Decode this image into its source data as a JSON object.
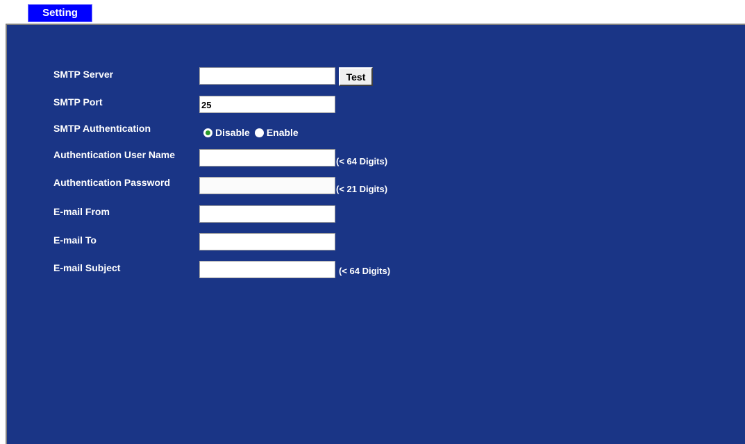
{
  "tab": {
    "label": "Setting"
  },
  "form": {
    "smtp_server": {
      "label": "SMTP Server",
      "value": ""
    },
    "test_button": {
      "label": "Test"
    },
    "smtp_port": {
      "label": "SMTP Port",
      "value": "25"
    },
    "smtp_auth": {
      "label": "SMTP Authentication",
      "options": [
        "Disable",
        "Enable"
      ],
      "selected": "Disable"
    },
    "auth_user": {
      "label": "Authentication User Name",
      "value": "",
      "hint": "(< 64 Digits)"
    },
    "auth_password": {
      "label": "Authentication Password",
      "value": "",
      "hint": "(< 21 Digits)"
    },
    "email_from": {
      "label": "E-mail From",
      "value": ""
    },
    "email_to": {
      "label": "E-mail To",
      "value": ""
    },
    "email_subject": {
      "label": "E-mail Subject",
      "value": "",
      "hint": "(< 64 Digits)"
    }
  },
  "colors": {
    "panel_background": "#1a3586",
    "tab_background": "#0000ff",
    "radio_selected": "#2a9a2a"
  }
}
